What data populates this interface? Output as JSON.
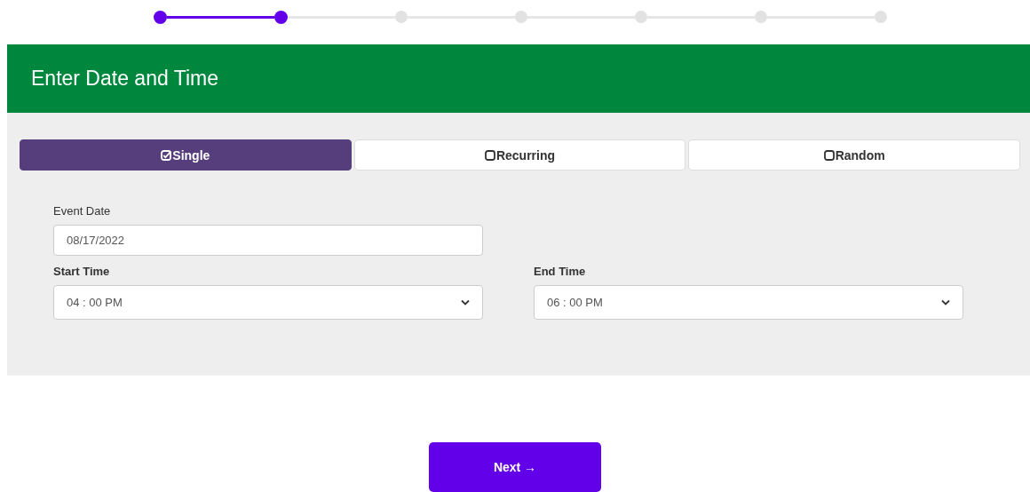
{
  "stepper": {
    "steps": [
      {
        "done": true
      },
      {
        "done": true
      },
      {
        "done": false
      },
      {
        "done": false
      },
      {
        "done": false
      },
      {
        "done": false
      },
      {
        "done": false
      }
    ]
  },
  "header": {
    "title": "Enter Date and Time"
  },
  "tabs": [
    {
      "label": "Single",
      "selected": true
    },
    {
      "label": "Recurring",
      "selected": false
    },
    {
      "label": "Random",
      "selected": false
    }
  ],
  "fields": [
    {
      "kind": "date",
      "label": "Event Date",
      "value": "08/17/2022"
    },
    {
      "kind": "select",
      "label": "Start Time",
      "value": "04 : 00 PM"
    },
    {
      "kind": "select",
      "label": "End Time",
      "value": "06 : 00 PM"
    }
  ],
  "next_button": {
    "label": "Next →"
  }
}
